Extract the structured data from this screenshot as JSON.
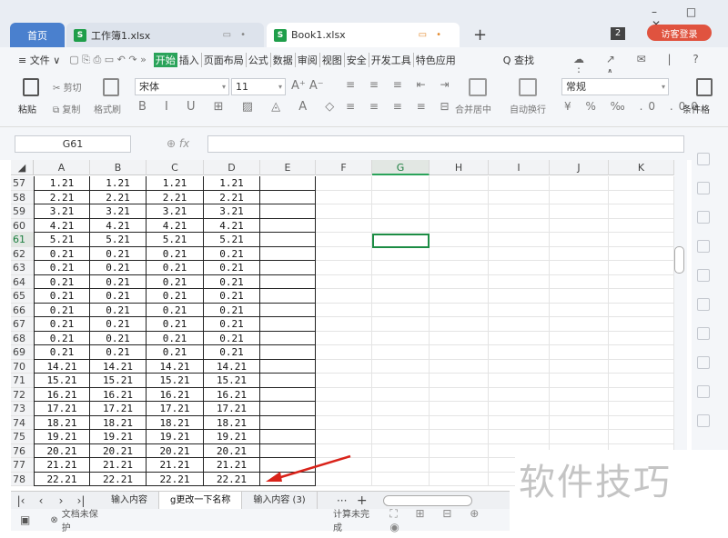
{
  "titlebar": {
    "home_tab": "首页",
    "tab1": "工作簿1.xlsx",
    "tab2": "Book1.xlsx",
    "file_icon": "S",
    "new_tab": "+",
    "badge": "2",
    "guest_login": "访客登录",
    "window_controls": "– □ ✕"
  },
  "menubar": {
    "file": "≡ 文件 ∨",
    "quick_access": "▢ ⎘ ⎙ ▭ ↶ ↷ »",
    "tabs": [
      "开始",
      "插入",
      "页面布局",
      "公式",
      "数据",
      "审阅",
      "视图",
      "安全",
      "开发工具",
      "特色应用"
    ],
    "search": "Q 查找"
  },
  "ribbon": {
    "paste": "粘贴",
    "cut": "剪切",
    "copy": "复制",
    "format_painter": "格式刷",
    "font_name": "宋体",
    "font_size": "11",
    "merge_center": "合并居中",
    "wrap_text": "自动换行",
    "number_format": "常规",
    "cond_format": "条件格"
  },
  "formula_bar": {
    "name_box": "G61",
    "fx": "fx",
    "formula": ""
  },
  "grid": {
    "columns": [
      "A",
      "B",
      "C",
      "D",
      "E",
      "F",
      "G",
      "H",
      "I",
      "J",
      "K"
    ],
    "selected_column": "G",
    "selected_row": "61",
    "rows": [
      {
        "n": "57",
        "v": "1.21"
      },
      {
        "n": "58",
        "v": "2.21"
      },
      {
        "n": "59",
        "v": "3.21"
      },
      {
        "n": "60",
        "v": "4.21"
      },
      {
        "n": "61",
        "v": "5.21"
      },
      {
        "n": "62",
        "v": "0.21"
      },
      {
        "n": "63",
        "v": "0.21"
      },
      {
        "n": "64",
        "v": "0.21"
      },
      {
        "n": "65",
        "v": "0.21"
      },
      {
        "n": "66",
        "v": "0.21"
      },
      {
        "n": "67",
        "v": "0.21"
      },
      {
        "n": "68",
        "v": "0.21"
      },
      {
        "n": "69",
        "v": "0.21"
      },
      {
        "n": "70",
        "v": "14.21"
      },
      {
        "n": "71",
        "v": "15.21"
      },
      {
        "n": "72",
        "v": "16.21"
      },
      {
        "n": "73",
        "v": "17.21"
      },
      {
        "n": "74",
        "v": "18.21"
      },
      {
        "n": "75",
        "v": "19.21"
      },
      {
        "n": "76",
        "v": "20.21"
      },
      {
        "n": "77",
        "v": "21.21"
      },
      {
        "n": "78",
        "v": "22.21"
      }
    ]
  },
  "sheets": {
    "tabs": [
      "输入内容",
      "g更改一下名称",
      "输入内容 (3)"
    ],
    "active_index": 1,
    "more": "···",
    "add": "+"
  },
  "statusbar": {
    "protect": "文档未保护",
    "calc": "计算未完成"
  },
  "watermark": "软件技巧",
  "colors": {
    "accent_green": "#2aa35a",
    "home_tab_blue": "#4a80ce",
    "guest_red": "#e0533f",
    "arrow_red": "#d9231a"
  }
}
